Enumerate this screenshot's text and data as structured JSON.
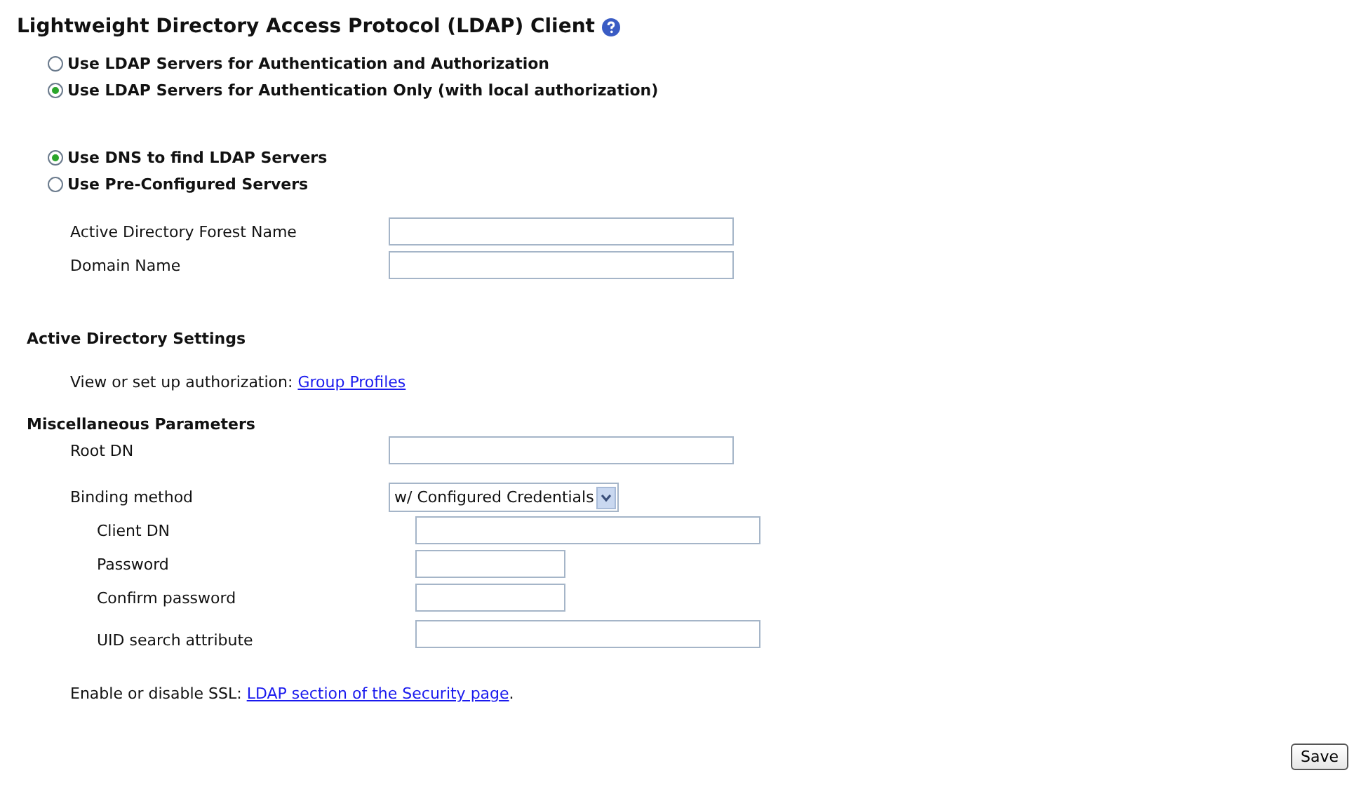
{
  "title": "Lightweight Directory Access Protocol (LDAP) Client",
  "auth_mode": [
    {
      "label": "Use LDAP Servers for Authentication and Authorization",
      "selected": false
    },
    {
      "label": "Use LDAP Servers for Authentication Only (with local authorization)",
      "selected": true
    }
  ],
  "server_mode": [
    {
      "label": "Use DNS to find LDAP Servers",
      "selected": true
    },
    {
      "label": "Use Pre-Configured Servers",
      "selected": false
    }
  ],
  "dns_fields": [
    {
      "label": "Active Directory Forest Name"
    },
    {
      "label": "Domain Name"
    }
  ],
  "ad_settings": {
    "heading": "Active Directory Settings",
    "text": "View or set up authorization:",
    "link": "Group Profiles"
  },
  "misc": {
    "heading": "Miscellaneous Parameters",
    "root_dn": {
      "label": "Root DN"
    },
    "binding": {
      "label": "Binding method",
      "value": "w/ Configured Credentials"
    },
    "sub_fields": [
      {
        "label": "Client DN",
        "kind": "text"
      },
      {
        "label": "Password",
        "kind": "password"
      },
      {
        "label": "Confirm password",
        "kind": "password"
      },
      {
        "label": "UID search attribute",
        "kind": "text"
      }
    ]
  },
  "ssl": {
    "text": "Enable or disable SSL:",
    "link": "LDAP section of the Security page",
    "suffix": "."
  },
  "save_button": "Save"
}
